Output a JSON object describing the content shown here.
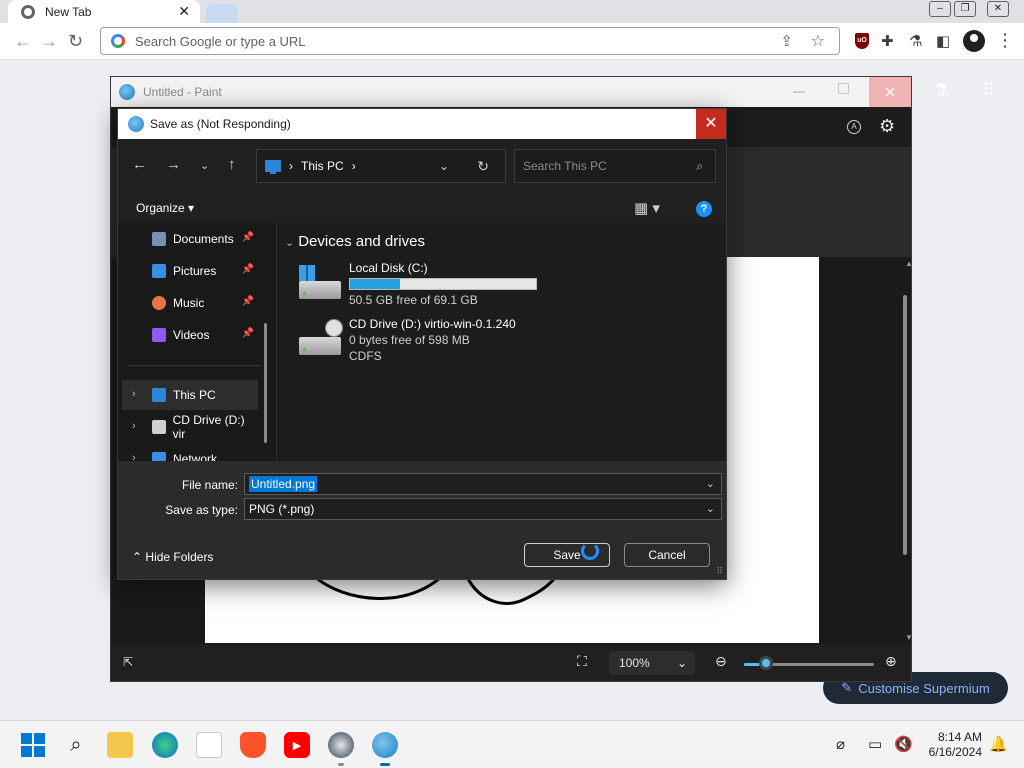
{
  "browser": {
    "tab_title": "New Tab",
    "tab_close": "✕",
    "omnibox_placeholder": "Search Google or type a URL",
    "customise_label": "Customise Supermium"
  },
  "paint": {
    "window_title": "Untitled - Paint",
    "zoom_value": "100%",
    "zoom_fraction": 0.17
  },
  "dialog": {
    "title": "Save as (Not Responding)",
    "address_crumb": "This PC",
    "search_placeholder": "Search This PC",
    "organize_label": "Organize",
    "nav_items": [
      {
        "label": "Documents",
        "pinned": true,
        "color": "#7a8fb3"
      },
      {
        "label": "Pictures",
        "pinned": true,
        "color": "#3a8ee6"
      },
      {
        "label": "Music",
        "pinned": true,
        "color": "#e8734a"
      },
      {
        "label": "Videos",
        "pinned": true,
        "color": "#8b5cf6"
      },
      {
        "label": "This PC",
        "selected": true,
        "color": "#2a86d8"
      },
      {
        "label": "CD Drive (D:) vir",
        "color": "#d0d0d0"
      },
      {
        "label": "Network",
        "color": "#3a8ee6"
      }
    ],
    "group_header": "Devices and drives",
    "drives": [
      {
        "name": "Local Disk (C:)",
        "free_text": "50.5 GB free of 69.1 GB",
        "used_fraction": 0.27
      },
      {
        "name": "CD Drive (D:) virtio-win-0.1.240",
        "free_text": "0 bytes free of 598 MB",
        "fs": "CDFS"
      }
    ],
    "file_name_label": "File name:",
    "file_name_value": "Untitled.png",
    "save_type_label": "Save as type:",
    "save_type_value": "PNG (*.png)",
    "hide_folders_label": "Hide Folders",
    "save_label": "Save",
    "cancel_label": "Cancel"
  },
  "taskbar": {
    "time": "8:14 AM",
    "date": "6/16/2024"
  },
  "colors": {
    "accent": "#0078d4",
    "close_red": "#c42b1c",
    "progress_blue": "#26a0da"
  }
}
